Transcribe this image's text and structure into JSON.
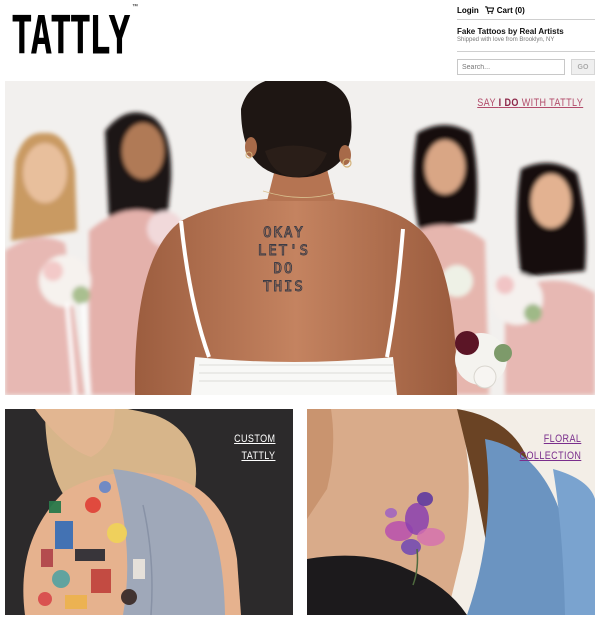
{
  "brand": {
    "logo_text": "TATTLY",
    "trademark": "™"
  },
  "nav": {
    "login": "Login",
    "cart": "Cart (0)"
  },
  "header": {
    "tagline": "Fake Tattoos by Real Artists",
    "subtagline": "Shipped with love from Brooklyn, NY"
  },
  "search": {
    "placeholder": "Search...",
    "go": "GO"
  },
  "hero": {
    "promo_prefix": "SAY ",
    "promo_emphasis": "I DO",
    "promo_suffix": " WITH TATTLY",
    "tattoo_lines": [
      "OKAY",
      "LET'S",
      "DO",
      "THIS"
    ]
  },
  "promos": {
    "custom_line1": "CUSTOM",
    "custom_line2": "TATTLY",
    "floral_line1": "FLORAL",
    "floral_line2": "COLLECTION"
  },
  "colors": {
    "hero_link": "#b24b6a",
    "floral_link": "#7a2e8c",
    "custom_bg": "#2c2a2b",
    "dress_pink": "#e7b8b3"
  }
}
